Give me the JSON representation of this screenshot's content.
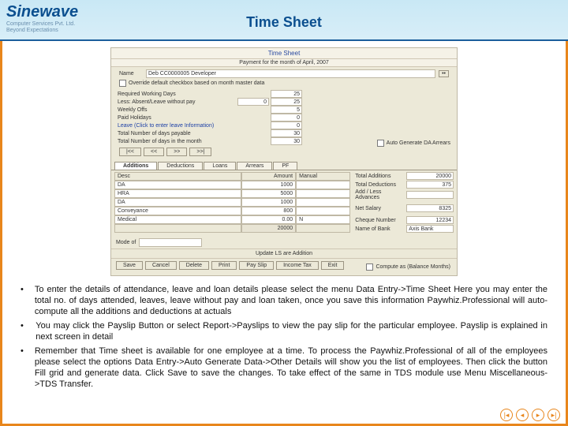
{
  "logo": {
    "name": "Sinewave",
    "line1": "Computer Services Pvt. Ltd.",
    "line2": "Beyond Expectations"
  },
  "title": "Time Sheet",
  "screenshot": {
    "window_title": "Time Sheet",
    "subtitle": "Payment for the month of April, 2007",
    "name_label": "Name",
    "name_value": "Deb  CC0000005  Developer",
    "override_cb": "Override default checkbox based on month master data",
    "rows": {
      "req_label": "Required Working Days",
      "req_val": "25",
      "absent_label": "Less: Absent/Leave without pay",
      "absent_field": "0",
      "absent_val": "25",
      "weekly_label": "Weekly Offs",
      "weekly_val": "5",
      "paid_label": "Paid Holidays",
      "paid_val": "0",
      "leave_label": "Leave (Click to enter leave Information)",
      "leave_val": "0",
      "payable_label": "Total Number of days payable",
      "payable_val": "30",
      "inmonth_label": "Total Number of days in the month",
      "inmonth_val": "30"
    },
    "right_cb": "Auto Generate DA Arrears",
    "nav_buttons": {
      "first": "|<<",
      "prev": "<<",
      "next": ">>",
      "last": ">>|"
    },
    "tabs": [
      "Additions",
      "Deductions",
      "Loans",
      "Arrears",
      "PF"
    ],
    "table_head": {
      "c1": "Desc",
      "c2": "Amount",
      "c3": "Manual"
    },
    "additions": [
      {
        "desc": "DA",
        "amount": "1000",
        "manual": ""
      },
      {
        "desc": "HRA",
        "amount": "5000",
        "manual": ""
      },
      {
        "desc": "DA",
        "amount": "1000",
        "manual": ""
      },
      {
        "desc": "Conveyance",
        "amount": "800",
        "manual": ""
      },
      {
        "desc": "Medical",
        "amount": "0.00",
        "manual": "N"
      }
    ],
    "additions_total": "20000",
    "summary": {
      "tot_add_l": "Total Additions",
      "tot_add_v": "20000",
      "tot_ded_l": "Total Deductions",
      "tot_ded_v": "375",
      "addl_l": "Add / Less Advances",
      "addl_v": "",
      "net_l": "Net Salary",
      "net_v": "8325",
      "chq_l": "Cheque Number",
      "chq_v": "12234",
      "bank_l": "Name of Bank",
      "bank_v": "Axis Bank"
    },
    "mode_label": "Mode of",
    "update_label": "Update LS are Addition",
    "bottom_buttons": [
      "Save",
      "Cancel",
      "Delete",
      "Print",
      "Pay Slip",
      "Income Tax",
      "Exit"
    ],
    "compute_cb": "Compute as (Balance Months)"
  },
  "bullets": [
    "To enter the details of attendance, leave and loan details please select the menu Data Entry->Time Sheet Here you may enter the total no. of days attended, leaves, leave without pay and  loan taken, once you save this information Paywhiz.Professional will auto-compute all the additions and deductions at actuals",
    "You may click the Payslip Button or select Report->Payslips to view the pay slip for the particular employee. Payslip is explained in next screen in detail",
    "Remember that Time sheet is available for one employee at a time. To process the Paywhiz.Professional of all of the employees please select the options Data Entry->Auto Generate Data->Other Details will show you the list of employees. Then click the button Fill grid and generate data. Click Save to save the changes. To take effect of the same in TDS module use Menu Miscellaneous->TDS Transfer."
  ],
  "nav_icons": {
    "first": "|◂",
    "prev": "◂",
    "next": "▸",
    "last": "▸|"
  }
}
